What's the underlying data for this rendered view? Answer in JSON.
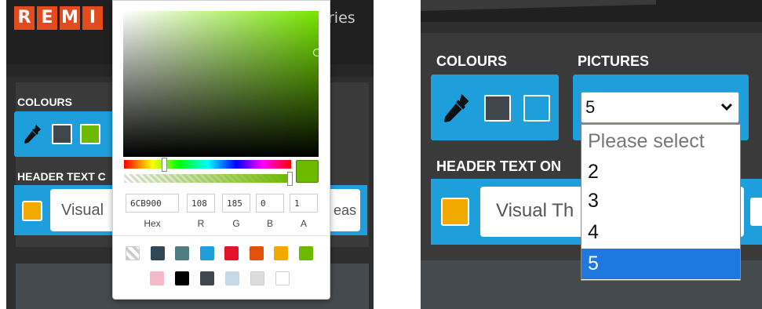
{
  "left": {
    "logo_letters": [
      "R",
      "E",
      "M",
      "I"
    ],
    "nav_partial": "ries",
    "colours_label": "COLOURS",
    "header_label": "HEADER TEXT C",
    "header_input_value": "Visual",
    "header_input_tail": "eas",
    "swatch_colors": {
      "dark": "#3f474c",
      "green": "#6cb900"
    },
    "header_swatch_color": "#f2a900"
  },
  "picker": {
    "hex_value": "6CB900",
    "r_value": "108",
    "g_value": "185",
    "b_value": "0",
    "a_value": "1",
    "hex_label": "Hex",
    "r_label": "R",
    "g_label": "G",
    "b_label": "B",
    "a_label": "A",
    "preset_colors_row1": [
      "transparent",
      "#2f4858",
      "#4f7d84",
      "#1e9fdc",
      "#e3122d",
      "#e0520e",
      "#f2a900",
      "#6cb900"
    ],
    "preset_colors_row2": [
      "#f7b8cc",
      "#000000",
      "#3f474c",
      "#c5d9e6",
      "#dcdcdc",
      "#ffffff"
    ]
  },
  "right": {
    "colours_label": "COLOURS",
    "pictures_label": "PICTURES",
    "header_label": "HEADER TEXT ON",
    "select_value": "5",
    "options": [
      "Please select",
      "2",
      "3",
      "4",
      "5"
    ],
    "selected_option": "5",
    "header_input_value": "Visual Th",
    "swatch_colors": {
      "dark": "#3f474c",
      "blue": "#1e9fdc"
    },
    "header_swatch_color": "#f2a900"
  },
  "accent_color": "#1e9fdc"
}
